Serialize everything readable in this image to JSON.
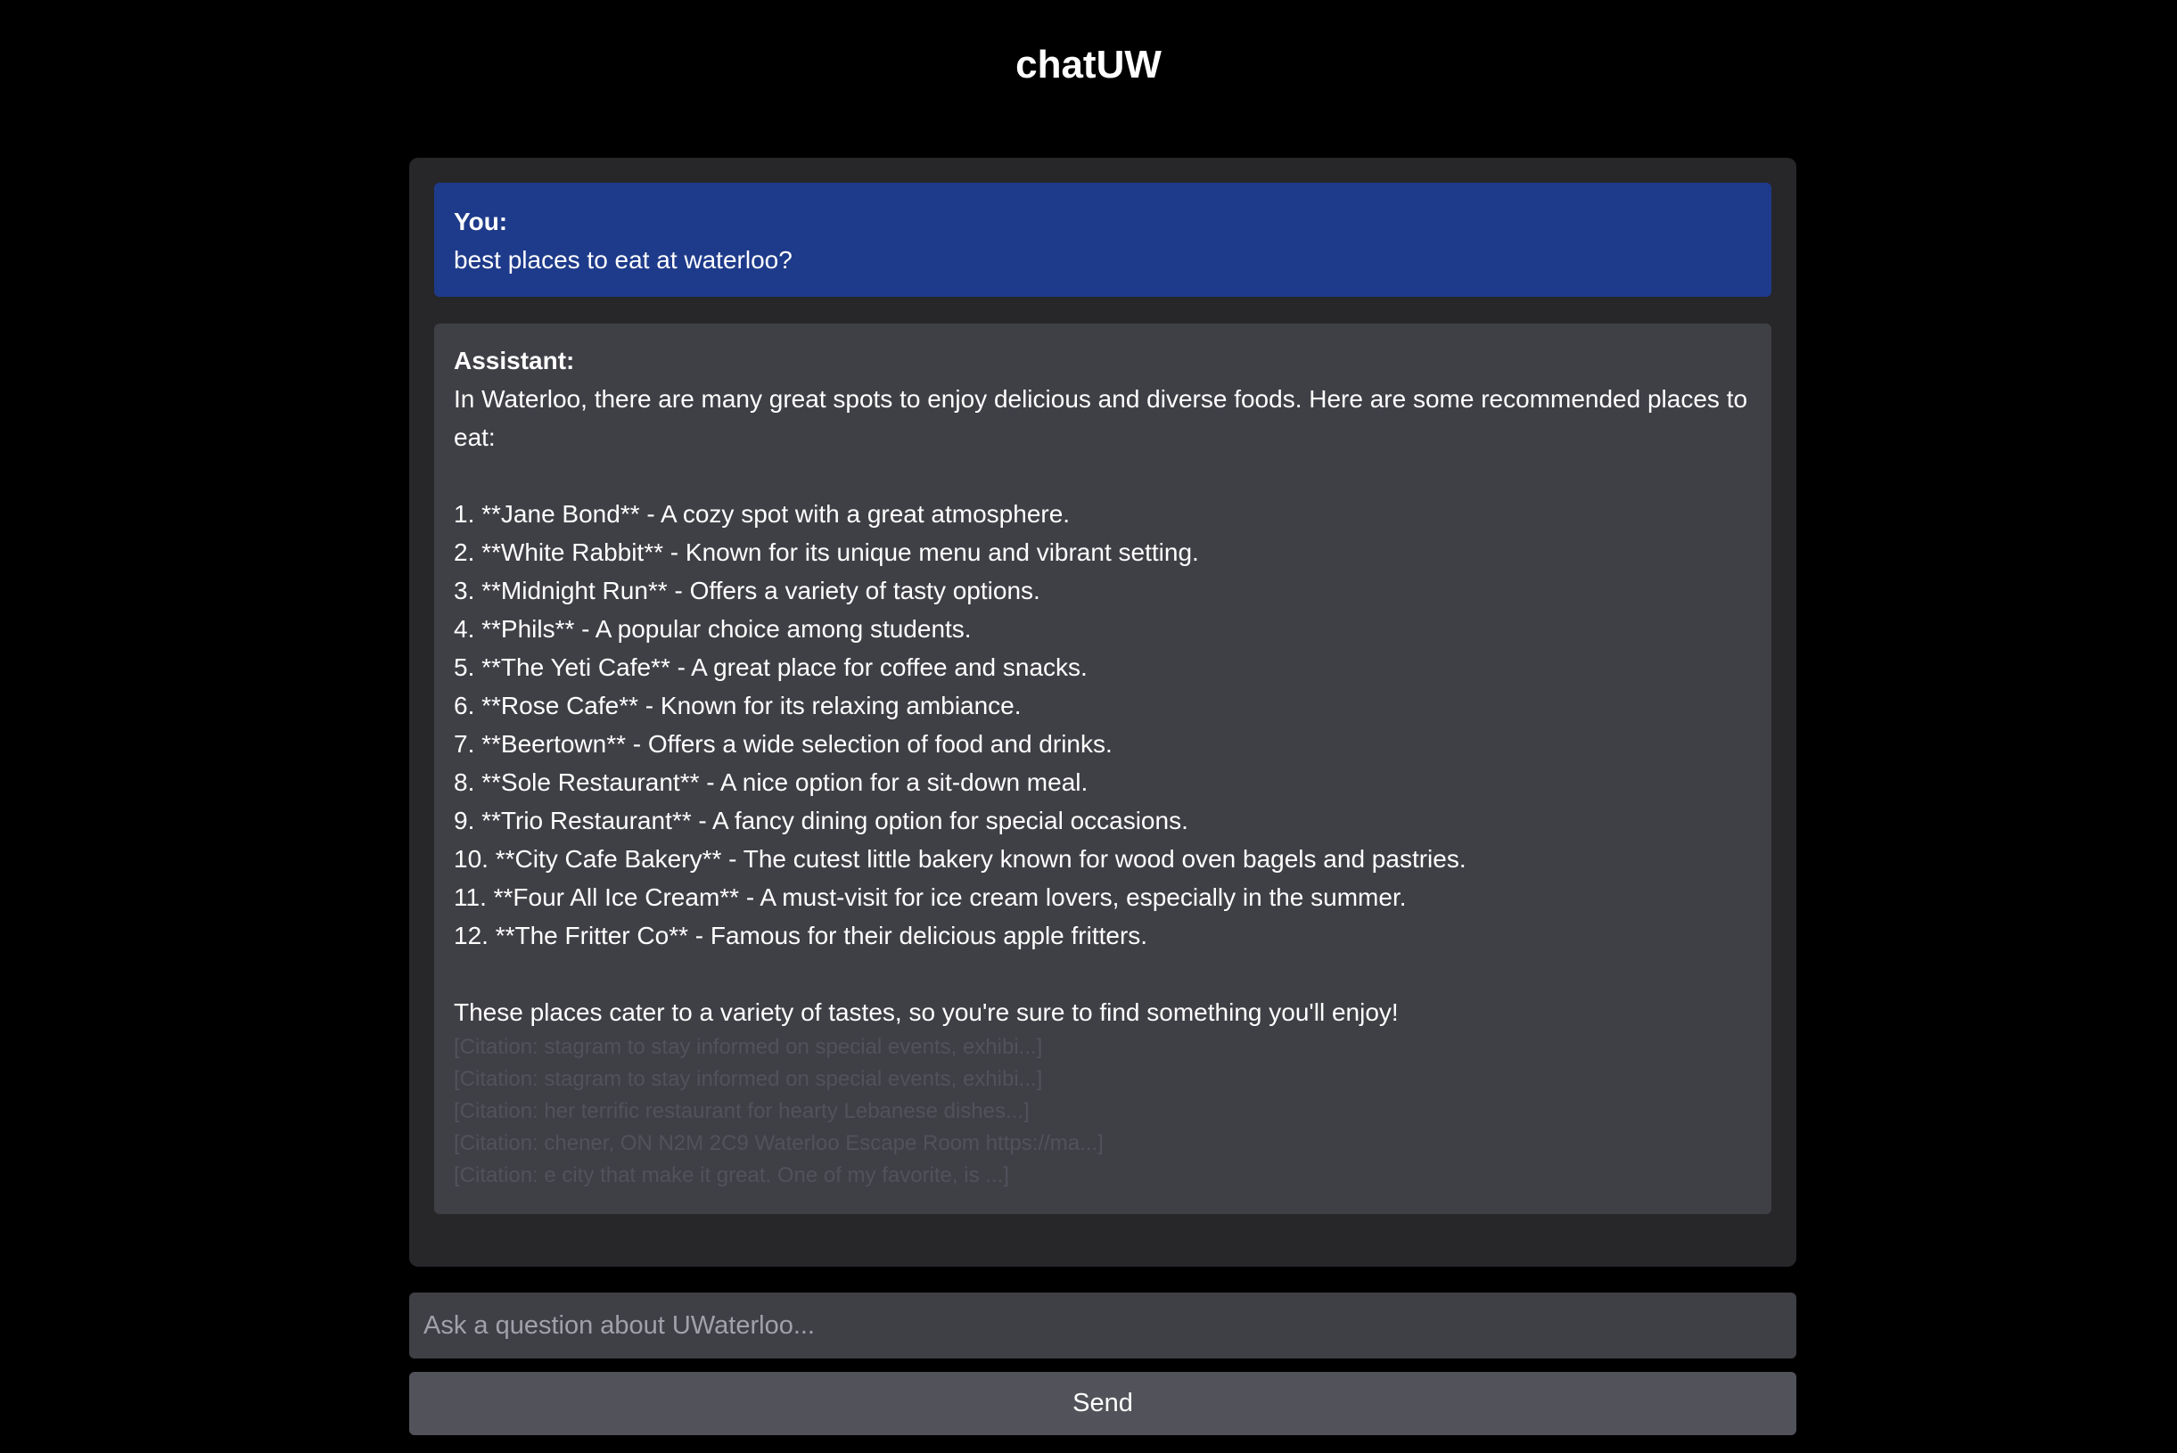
{
  "app": {
    "title": "chatUW"
  },
  "conversation": {
    "user_message": {
      "speaker": "You:",
      "text": "best places to eat at waterloo?"
    },
    "assistant_message": {
      "speaker": "Assistant:",
      "intro": "In Waterloo, there are many great spots to enjoy delicious and diverse foods. Here are some recommended places to eat:",
      "list": [
        "1. **Jane Bond** - A cozy spot with a great atmosphere.",
        "2. **White Rabbit** - Known for its unique menu and vibrant setting.",
        "3. **Midnight Run** - Offers a variety of tasty options.",
        "4. **Phils** - A popular choice among students.",
        "5. **The Yeti Cafe** - A great place for coffee and snacks.",
        "6. **Rose Cafe** - Known for its relaxing ambiance.",
        "7. **Beertown** - Offers a wide selection of food and drinks.",
        "8. **Sole Restaurant** - A nice option for a sit-down meal.",
        "9. **Trio Restaurant** - A fancy dining option for special occasions.",
        "10. **City Cafe Bakery** - The cutest little bakery known for wood oven bagels and pastries.",
        "11. **Four All Ice Cream** - A must-visit for ice cream lovers, especially in the summer.",
        "12. **The Fritter Co** - Famous for their delicious apple fritters."
      ],
      "closing": "These places cater to a variety of tastes, so you're sure to find something you'll enjoy!",
      "citations": [
        "[Citation: stagram to stay informed on special events, exhibi...]",
        "[Citation: stagram to stay informed on special events, exhibi...]",
        "[Citation: her terrific restaurant for hearty Lebanese dishes...]",
        "[Citation: chener, ON N2M 2C9 Waterloo Escape Room https://ma...]",
        "[Citation: e city that make it great. One of my favorite, is ...]"
      ]
    }
  },
  "composer": {
    "placeholder": "Ask a question about UWaterloo...",
    "value": "",
    "send_label": "Send"
  },
  "colors": {
    "background": "#000000",
    "panel": "#27272a",
    "user_bubble": "#1e3a8a",
    "assistant_bubble": "#3f3f46",
    "citation_text": "#52525b",
    "send_button": "#52525b"
  }
}
